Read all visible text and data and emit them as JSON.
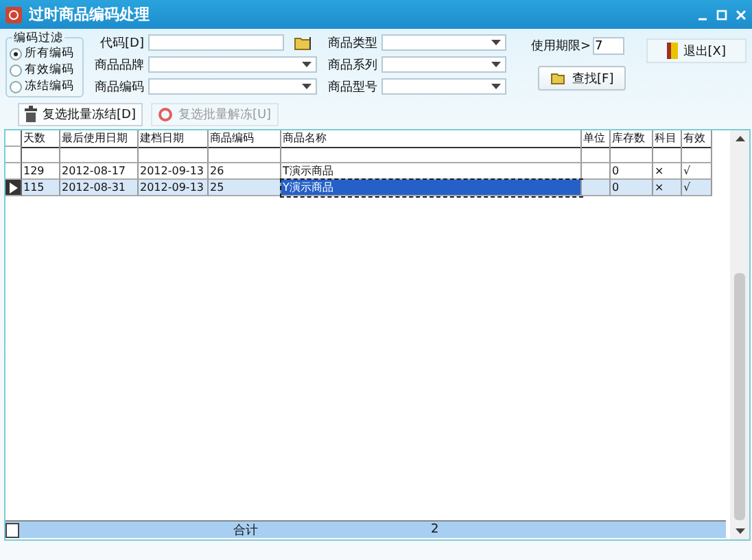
{
  "window": {
    "title": "过时商品编码处理"
  },
  "filter_group": {
    "title": "编码过滤",
    "options": [
      {
        "label": "所有编码",
        "selected": true
      },
      {
        "label": "有效编码",
        "selected": false
      },
      {
        "label": "冻结编码",
        "selected": false
      }
    ]
  },
  "fields": [
    {
      "label": "代码[D]",
      "kind": "browse"
    },
    {
      "label": "商品品牌",
      "kind": "dropdown"
    },
    {
      "label": "商品编码",
      "kind": "dropdown"
    },
    {
      "label": "商品类型",
      "kind": "dropdown"
    },
    {
      "label": "商品系列",
      "kind": "dropdown"
    },
    {
      "label": "商品型号",
      "kind": "dropdown"
    }
  ],
  "usage_limit": {
    "label": "使用期限>",
    "value": "7"
  },
  "search_button": {
    "label": "查找[F]"
  },
  "exit_button": {
    "label": "退出[X]"
  },
  "toolbar": [
    {
      "label": "复选批量冻结[D]",
      "disabled": false
    },
    {
      "label": "复选批量解冻[U]",
      "disabled": true
    }
  ],
  "table": {
    "columns": [
      "天数",
      "最后使用日期",
      "建档日期",
      "商品编码",
      "商品名称",
      "单位",
      "库存数",
      "科目",
      "有效"
    ],
    "rows": [
      {
        "cells": [
          "129",
          "2012-08-17",
          "2012-09-13",
          "26",
          "T演示商品",
          "",
          "0",
          "×",
          "√"
        ],
        "selected": false
      },
      {
        "cells": [
          "115",
          "2012-08-31",
          "2012-09-13",
          "25",
          "Y演示商品",
          "",
          "0",
          "×",
          "√"
        ],
        "selected": true
      }
    ]
  },
  "footer": {
    "label": "合计",
    "count": "2"
  }
}
